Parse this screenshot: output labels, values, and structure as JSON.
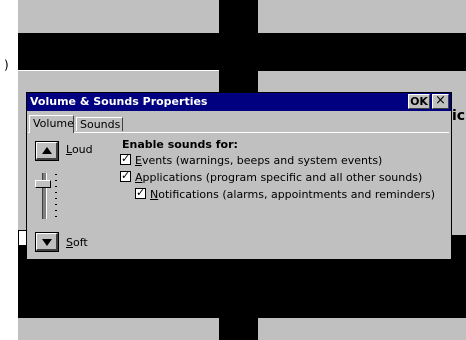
{
  "dialog": {
    "title": "Volume & Sounds Properties",
    "ok_label": "OK",
    "close_label": "×"
  },
  "tabs": [
    {
      "label": "Volume",
      "active": true
    },
    {
      "label": "Sounds",
      "active": false
    }
  ],
  "volume": {
    "loud_label_accel": "L",
    "loud_label_rest": "oud",
    "soft_label_accel": "S",
    "soft_label_rest": "oft",
    "level": 0.85
  },
  "sounds": {
    "enable_label": "Enable sounds for:",
    "options": [
      {
        "accel": "E",
        "rest": "vents (warnings, beeps and system events)",
        "checked": true
      },
      {
        "accel": "A",
        "rest": "pplications (program specific and all other sounds)",
        "checked": true
      },
      {
        "accel": "N",
        "rest": "otifications (alarms, appointments and reminders)",
        "checked": true
      }
    ],
    "check_glyph": "✓"
  },
  "background": {
    "fragment_left": ")",
    "fragment_right": "ic"
  },
  "colors": {
    "title_bar": "#000080",
    "face": "#c0c0c0",
    "background_black": "#000000",
    "background_gray": "#c0c0c0"
  }
}
